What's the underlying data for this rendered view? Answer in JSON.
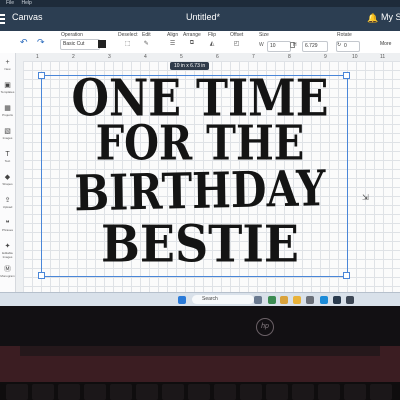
{
  "window": {
    "menu": [
      "File",
      "Help"
    ],
    "app_title": "Canvas",
    "doc_title": "Untitled*",
    "account": "My St"
  },
  "toolbar": {
    "operation_label": "Operation",
    "operation_value": "Basic Cut",
    "deselect": "Deselect",
    "edit": "Edit",
    "align": "Align",
    "arrange": "Arrange",
    "flip": "Flip",
    "offset": "Offset",
    "size_label": "Size",
    "width_label": "W",
    "width_value": "10",
    "height_label": "H",
    "height_value": "6.729",
    "rotate_label": "Rotate",
    "rotate_value": "0",
    "more": "More"
  },
  "sidebar": [
    "New",
    "Templates",
    "Projects",
    "Images",
    "Text",
    "Shapes",
    "Upload",
    "Phrases",
    "Editable Images",
    "Monogram"
  ],
  "ruler_marks": [
    "1",
    "2",
    "3",
    "4",
    "5",
    "6",
    "7",
    "8",
    "9",
    "10",
    "11"
  ],
  "selection": {
    "size_tag": "10 in x 6.73 in"
  },
  "design_text": [
    "ONE TIME",
    "FOR THE",
    "BIRTHDAY",
    "BESTIE"
  ],
  "taskbar": {
    "search_label": "Search"
  },
  "laptop": {
    "logo": "hp"
  }
}
